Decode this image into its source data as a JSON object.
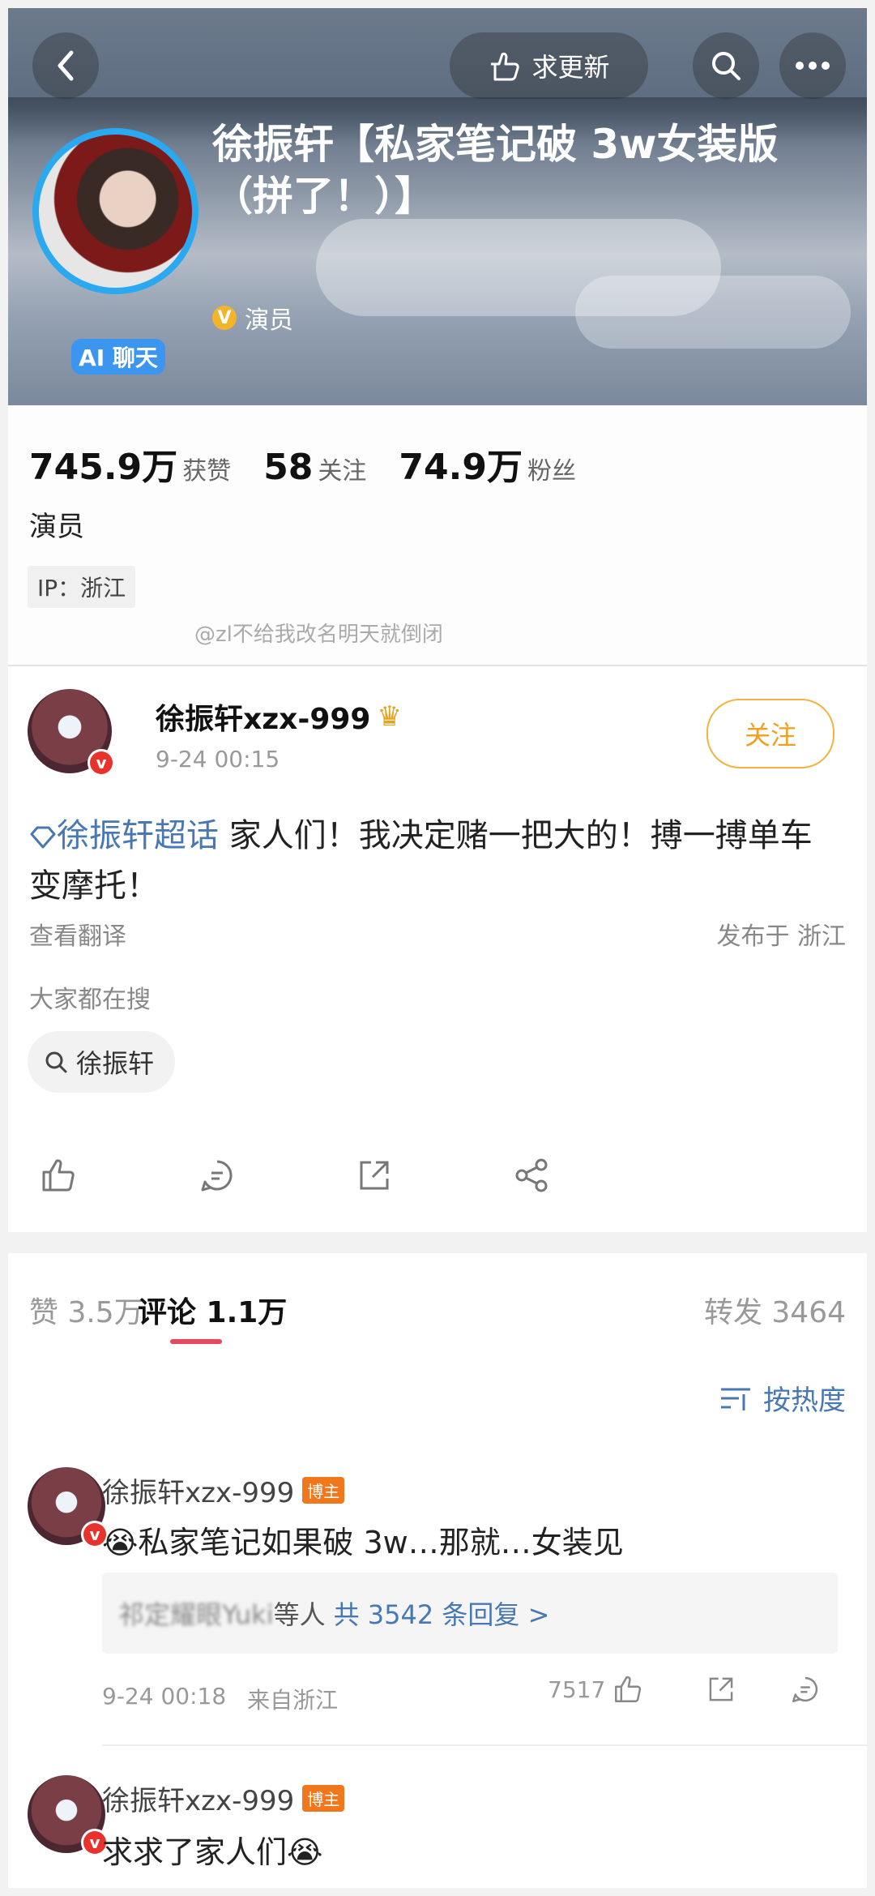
{
  "header": {
    "request_update": "求更新",
    "title": "徐振轩【私家笔记破 3w女装版（拼了！）】",
    "ai_chat": "AI 聊天",
    "verify_tag": "演员",
    "v_symbol": "V"
  },
  "profile": {
    "likes_count": "745.9万",
    "likes_label": "获赞",
    "following_count": "58",
    "following_label": "关注",
    "fans_count": "74.9万",
    "fans_label": "粉丝",
    "bio": "演员",
    "ip": "IP：浙江",
    "watermark": "@zl不给我改名明天就倒闭"
  },
  "post": {
    "author": "徐振轩xzx-999",
    "time": "9-24 00:15",
    "follow_label": "关注",
    "topic": "徐振轩超话",
    "text": " 家人们！我决定赌一把大的！搏一搏单车变摩托！",
    "translate": "查看翻译",
    "location": "发布于 浙江",
    "searching_label": "大家都在搜",
    "search_chip": "徐振轩",
    "v_symbol": "v"
  },
  "tabs": {
    "likes": "赞 3.5万",
    "comments": "评论 1.1万",
    "reposts": "转发 3464",
    "sort": "按热度"
  },
  "comments": [
    {
      "author": "徐振轩xzx-999",
      "badge": "博主",
      "text": "😭私家笔记如果破 3w…那就…女装见",
      "replies_blurred": "祁定耀眼Yuki",
      "replies_who": "等人",
      "replies_link": "共 3542 条回复 >",
      "time": "9-24 00:18",
      "source": "来自浙江",
      "likes": "7517"
    },
    {
      "author": "徐振轩xzx-999",
      "badge": "博主",
      "text": "求求了家人们😭"
    }
  ],
  "colors": {
    "accent_blue": "#4878b4",
    "follow_orange": "#f0a020",
    "tab_underline": "#e8485d",
    "host_badge": "#f0771c"
  }
}
